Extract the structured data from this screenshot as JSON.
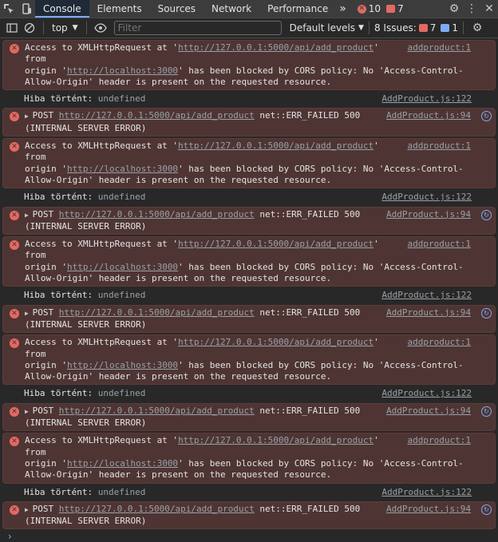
{
  "tabs": [
    "Console",
    "Elements",
    "Sources",
    "Network",
    "Performance"
  ],
  "overflow_glyph": "»",
  "tab_counts": {
    "errors": "10",
    "warnings": "7"
  },
  "toolbar": {
    "context": "top",
    "filter_placeholder": "Filter",
    "levels": "Default levels",
    "issues_label": "8 Issues:",
    "issues_errors": "7",
    "issues_info": "1"
  },
  "messages": [
    {
      "type": "cors",
      "src": "addproduct:1",
      "p1": "Access to XMLHttpRequest at '",
      "url": "http://127.0.0.1:5000/api/add_product",
      "p2": "' from",
      "p3": "origin '",
      "origin": "http://localhost:3000",
      "p4": "' has been blocked by CORS policy: No 'Access-Control-",
      "p5": "Allow-Origin' header is present on the requested resource."
    },
    {
      "type": "log",
      "text": "Hiba történt:",
      "value": "undefined",
      "src": "AddProduct.js:122"
    },
    {
      "type": "post",
      "method": "POST",
      "url": "http://127.0.0.1:5000/api/add_product",
      "status": "net::ERR_FAILED 500",
      "line2": "(INTERNAL SERVER ERROR)",
      "src": "AddProduct.js:94"
    },
    {
      "type": "cors",
      "src": "addproduct:1",
      "p1": "Access to XMLHttpRequest at '",
      "url": "http://127.0.0.1:5000/api/add_product",
      "p2": "' from",
      "p3": "origin '",
      "origin": "http://localhost:3000",
      "p4": "' has been blocked by CORS policy: No 'Access-Control-",
      "p5": "Allow-Origin' header is present on the requested resource."
    },
    {
      "type": "log",
      "text": "Hiba történt:",
      "value": "undefined",
      "src": "AddProduct.js:122"
    },
    {
      "type": "post",
      "method": "POST",
      "url": "http://127.0.0.1:5000/api/add_product",
      "status": "net::ERR_FAILED 500",
      "line2": "(INTERNAL SERVER ERROR)",
      "src": "AddProduct.js:94"
    },
    {
      "type": "cors",
      "src": "addproduct:1",
      "p1": "Access to XMLHttpRequest at '",
      "url": "http://127.0.0.1:5000/api/add_product",
      "p2": "' from",
      "p3": "origin '",
      "origin": "http://localhost:3000",
      "p4": "' has been blocked by CORS policy: No 'Access-Control-",
      "p5": "Allow-Origin' header is present on the requested resource."
    },
    {
      "type": "log",
      "text": "Hiba történt:",
      "value": "undefined",
      "src": "AddProduct.js:122"
    },
    {
      "type": "post",
      "method": "POST",
      "url": "http://127.0.0.1:5000/api/add_product",
      "status": "net::ERR_FAILED 500",
      "line2": "(INTERNAL SERVER ERROR)",
      "src": "AddProduct.js:94"
    },
    {
      "type": "cors",
      "src": "addproduct:1",
      "p1": "Access to XMLHttpRequest at '",
      "url": "http://127.0.0.1:5000/api/add_product",
      "p2": "' from",
      "p3": "origin '",
      "origin": "http://localhost:3000",
      "p4": "' has been blocked by CORS policy: No 'Access-Control-",
      "p5": "Allow-Origin' header is present on the requested resource."
    },
    {
      "type": "log",
      "text": "Hiba történt:",
      "value": "undefined",
      "src": "AddProduct.js:122"
    },
    {
      "type": "post",
      "method": "POST",
      "url": "http://127.0.0.1:5000/api/add_product",
      "status": "net::ERR_FAILED 500",
      "line2": "(INTERNAL SERVER ERROR)",
      "src": "AddProduct.js:94"
    },
    {
      "type": "cors",
      "src": "addproduct:1",
      "p1": "Access to XMLHttpRequest at '",
      "url": "http://127.0.0.1:5000/api/add_product",
      "p2": "' from",
      "p3": "origin '",
      "origin": "http://localhost:3000",
      "p4": "' has been blocked by CORS policy: No 'Access-Control-",
      "p5": "Allow-Origin' header is present on the requested resource."
    },
    {
      "type": "log",
      "text": "Hiba történt:",
      "value": "undefined",
      "src": "AddProduct.js:122"
    },
    {
      "type": "post",
      "method": "POST",
      "url": "http://127.0.0.1:5000/api/add_product",
      "status": "net::ERR_FAILED 500",
      "line2": "(INTERNAL SERVER ERROR)",
      "src": "AddProduct.js:94"
    }
  ],
  "colors": {
    "accent": "#7cacf8",
    "error": "#e46962",
    "error_bg": "#4e3534"
  }
}
